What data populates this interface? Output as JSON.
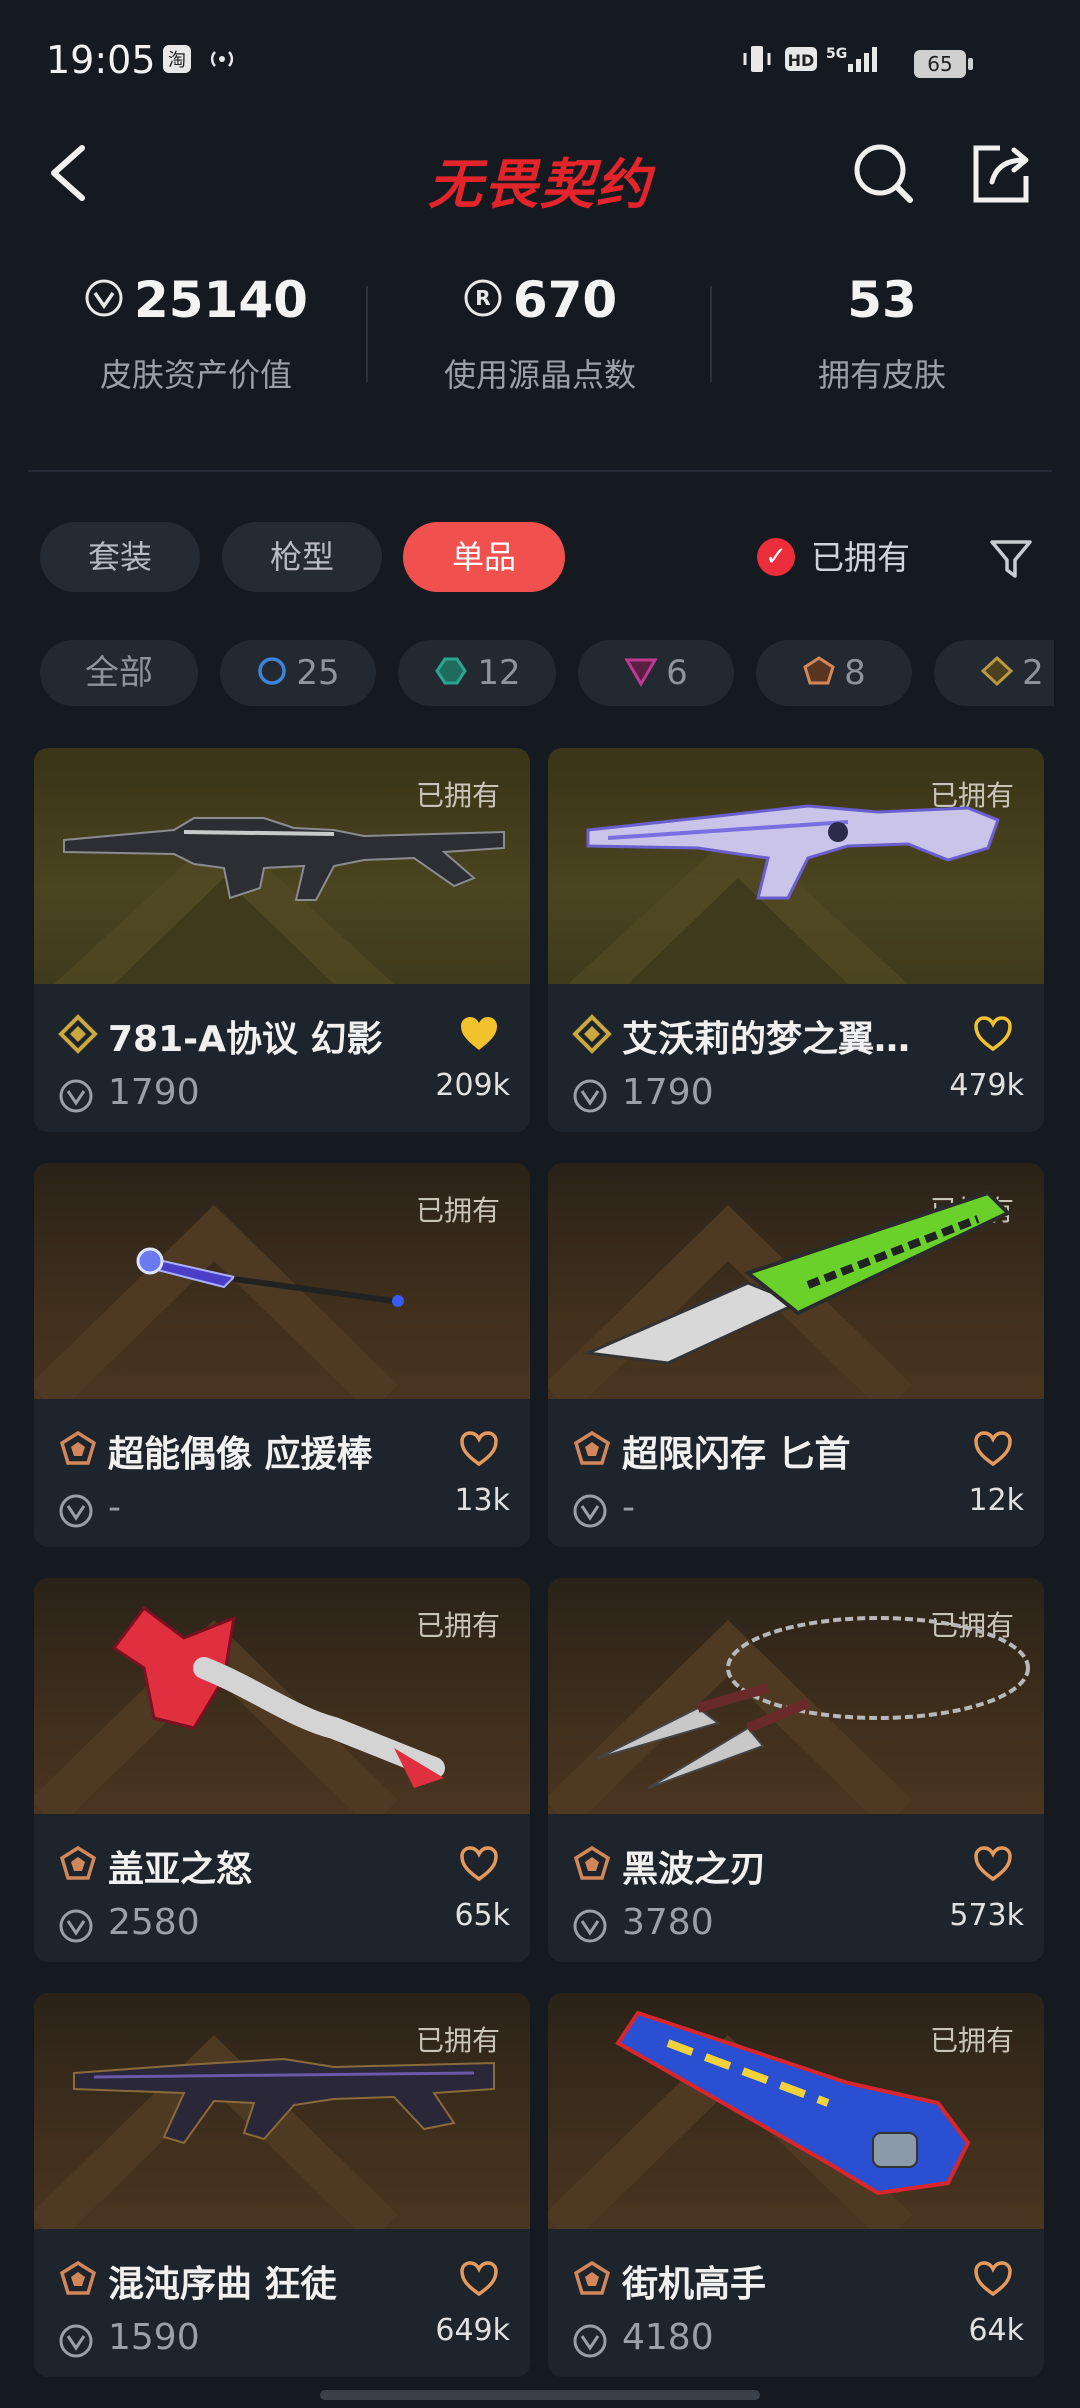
{
  "status": {
    "time": "19:05",
    "battery": "65",
    "network": "5G"
  },
  "nav": {
    "title": "无畏契约"
  },
  "stats": [
    {
      "value": "25140",
      "label": "皮肤资产价值",
      "icon": "vp-icon"
    },
    {
      "value": "670",
      "label": "使用源晶点数",
      "icon": "radianite-icon"
    },
    {
      "value": "53",
      "label": "拥有皮肤",
      "icon": ""
    }
  ],
  "tabs": [
    {
      "label": "套装",
      "active": false
    },
    {
      "label": "枪型",
      "active": false
    },
    {
      "label": "单品",
      "active": true
    }
  ],
  "owned_filter": {
    "label": "已拥有",
    "checked": true
  },
  "tiers": [
    {
      "label": "全部",
      "icon": ""
    },
    {
      "label": "25",
      "icon": "ultra-tier-icon",
      "color": "#3f82d8"
    },
    {
      "label": "12",
      "icon": "premium-tier-icon",
      "color": "#2aa58f"
    },
    {
      "label": "6",
      "icon": "exclusive-tier-icon",
      "color": "#c0398f"
    },
    {
      "label": "8",
      "icon": "deluxe-tier-icon",
      "color": "#d2875a"
    },
    {
      "label": "2",
      "icon": "select-tier-icon",
      "color": "#b99a3d"
    }
  ],
  "cards": [
    {
      "owned": "已拥有",
      "title": "781-A协议 幻影",
      "price": "1790",
      "likes": "209k",
      "liked": true,
      "tier": "gold"
    },
    {
      "owned": "已拥有",
      "title": "艾沃莉的梦之翼…",
      "price": "1790",
      "likes": "479k",
      "liked": false,
      "tier": "gold"
    },
    {
      "owned": "已拥有",
      "title": "超能偶像 应援棒",
      "price": "-",
      "likes": "13k",
      "liked": false,
      "tier": "brown"
    },
    {
      "owned": "已拥有",
      "title": "超限闪存 匕首",
      "price": "-",
      "likes": "12k",
      "liked": false,
      "tier": "brown"
    },
    {
      "owned": "已拥有",
      "title": "盖亚之怒",
      "price": "2580",
      "likes": "65k",
      "liked": false,
      "tier": "brown"
    },
    {
      "owned": "已拥有",
      "title": "黑波之刃",
      "price": "3780",
      "likes": "573k",
      "liked": false,
      "tier": "brown"
    },
    {
      "owned": "已拥有",
      "title": "混沌序曲 狂徒",
      "price": "1590",
      "likes": "649k",
      "liked": false,
      "tier": "brown"
    },
    {
      "owned": "已拥有",
      "title": "街机高手",
      "price": "4180",
      "likes": "64k",
      "liked": false,
      "tier": "brown"
    }
  ]
}
